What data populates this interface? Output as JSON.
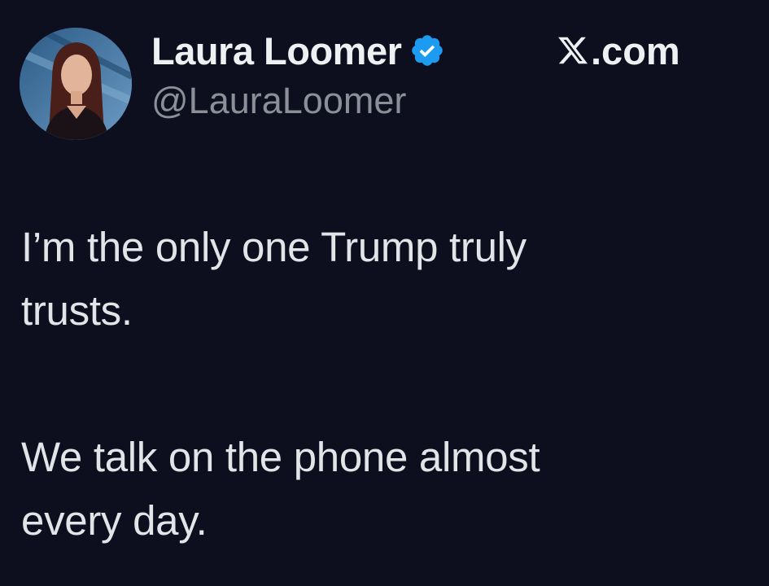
{
  "tweet": {
    "author": {
      "display_name": "Laura Loomer",
      "handle": "@LauraLoomer",
      "verified": true,
      "avatar_icon": "profile-photo"
    },
    "brand": {
      "icon": "x-logo-icon",
      "text": ".com"
    },
    "text_lines": [
      "I’m the only one Trump truly",
      "trusts.",
      "We talk on the phone almost",
      "every day."
    ]
  },
  "colors": {
    "background": "#0d0f1f",
    "text": "#e2e4e8",
    "handle": "#8b8f97",
    "verified_badge": "#1d9bf0"
  }
}
